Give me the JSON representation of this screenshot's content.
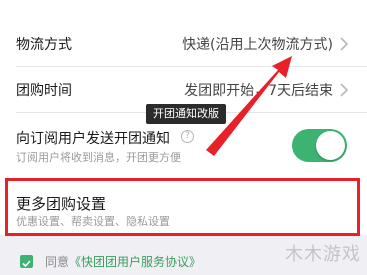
{
  "logistics": {
    "label": "物流方式",
    "value": "快递(沿用上次物流方式)"
  },
  "group_time": {
    "label": "团购时间",
    "value": "发团即开始，7天后结束"
  },
  "tooltip": {
    "text": "开团通知改版"
  },
  "notify": {
    "label": "向订阅用户发送开团通知",
    "help": "?",
    "subtext": "订阅用户将收到消息，开团更方便",
    "enabled": true
  },
  "more_settings": {
    "label": "更多团购设置",
    "subtext": "优惠设置、帮卖设置、隐私设置"
  },
  "agreement": {
    "prefix": "同意",
    "link": "《快团团用户服务协议》",
    "checked": true
  },
  "watermark": {
    "text": "木木游戏"
  },
  "colors": {
    "accent_green": "#3cb371",
    "highlight_red": "#e8202a"
  }
}
